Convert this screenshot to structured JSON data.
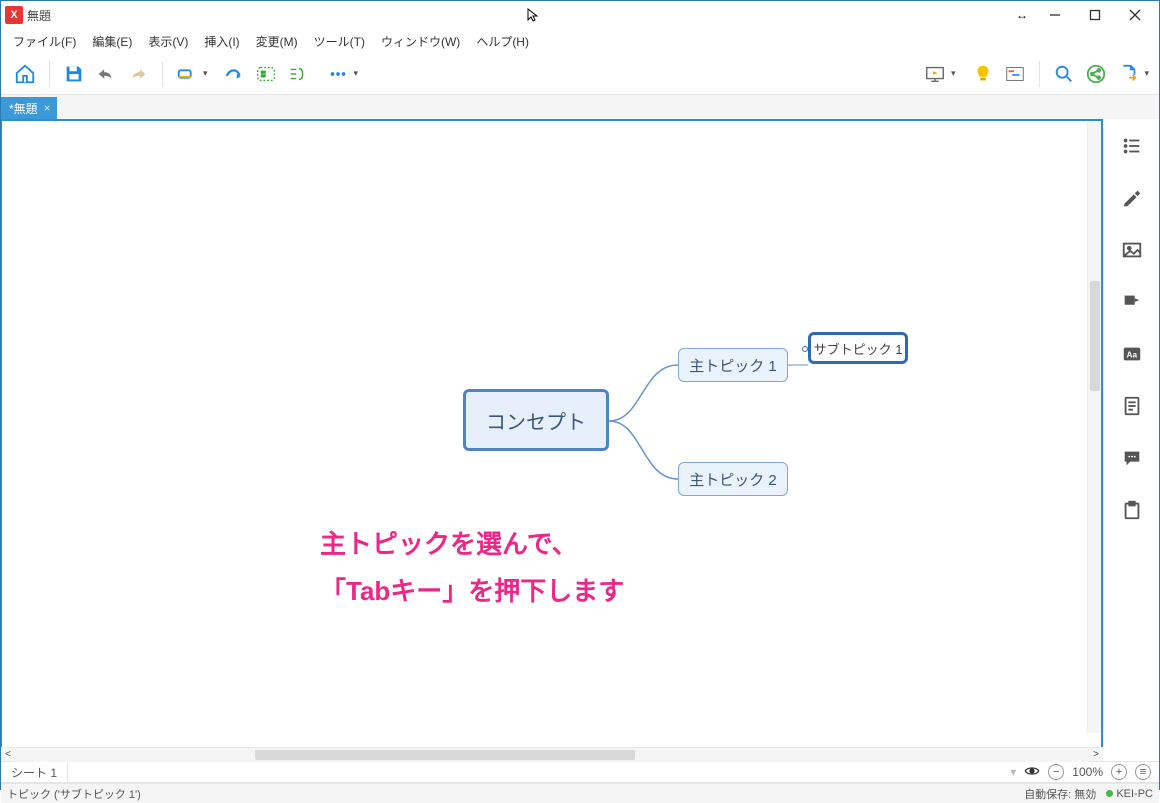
{
  "window": {
    "title": "無題"
  },
  "menu": {
    "file": "ファイル(F)",
    "edit": "編集(E)",
    "view": "表示(V)",
    "insert": "挿入(I)",
    "modify": "変更(M)",
    "tool": "ツール(T)",
    "window": "ウィンドウ(W)",
    "help": "ヘルプ(H)"
  },
  "tab": {
    "label": "*無題"
  },
  "mindmap": {
    "root": "コンセプト",
    "main1": "主トピック 1",
    "main2": "主トピック 2",
    "sub1": "サブトピック 1"
  },
  "annotation": {
    "line1": "主トピックを選んで、",
    "line2": "「Tabキー」を押下します"
  },
  "sheet": {
    "tab1": "シート 1"
  },
  "zoom": {
    "value": "100%"
  },
  "status": {
    "left": "トピック ('サブトピック 1')",
    "autosave": "自動保存: 無効",
    "machine": "KEI-PC"
  },
  "colors": {
    "accent": "#3b99d8",
    "annotation": "#ec2787"
  }
}
